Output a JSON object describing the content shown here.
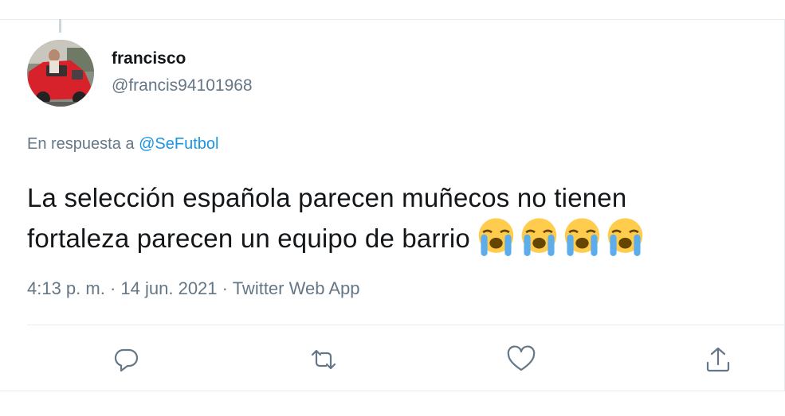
{
  "user": {
    "display_name": "francisco",
    "handle": "@francis94101968"
  },
  "reply": {
    "prefix": "En respuesta a",
    "target": "@SeFutbol"
  },
  "tweet": {
    "line1": "La selección española parecen muñecos no tienen",
    "line2": "fortaleza parecen un equipo de barrio",
    "emojis": [
      "loudly-crying-face",
      "loudly-crying-face",
      "loudly-crying-face",
      "loudly-crying-face"
    ]
  },
  "meta": {
    "time": "4:13 p. m.",
    "separator": "·",
    "date": "14 jun. 2021",
    "source": "Twitter Web App"
  },
  "actions": [
    "reply-icon",
    "retweet-icon",
    "like-icon",
    "share-icon"
  ],
  "colors": {
    "text": "#14171a",
    "secondary": "#657786",
    "link": "#1b95e0",
    "border": "#e6ecf0"
  }
}
